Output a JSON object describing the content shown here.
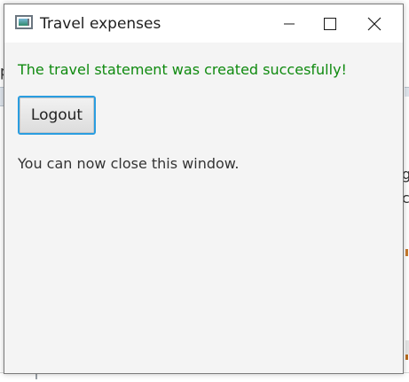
{
  "window": {
    "title": "Travel expenses",
    "controls": {
      "minimize": "minimize-icon",
      "maximize": "maximize-icon",
      "close": "close-icon"
    }
  },
  "dialog": {
    "success_message": "The travel statement was created succesfully!",
    "logout_label": "Logout",
    "info_message": "You can now close this window."
  },
  "background": {
    "left_fragment": "p",
    "right_fragment_1": "g",
    "right_fragment_2": "c",
    "right_fragment_3": "c"
  },
  "colors": {
    "success_text": "#0f8a0f",
    "button_focus_border": "#2a9de0",
    "window_background": "#f4f4f4"
  }
}
